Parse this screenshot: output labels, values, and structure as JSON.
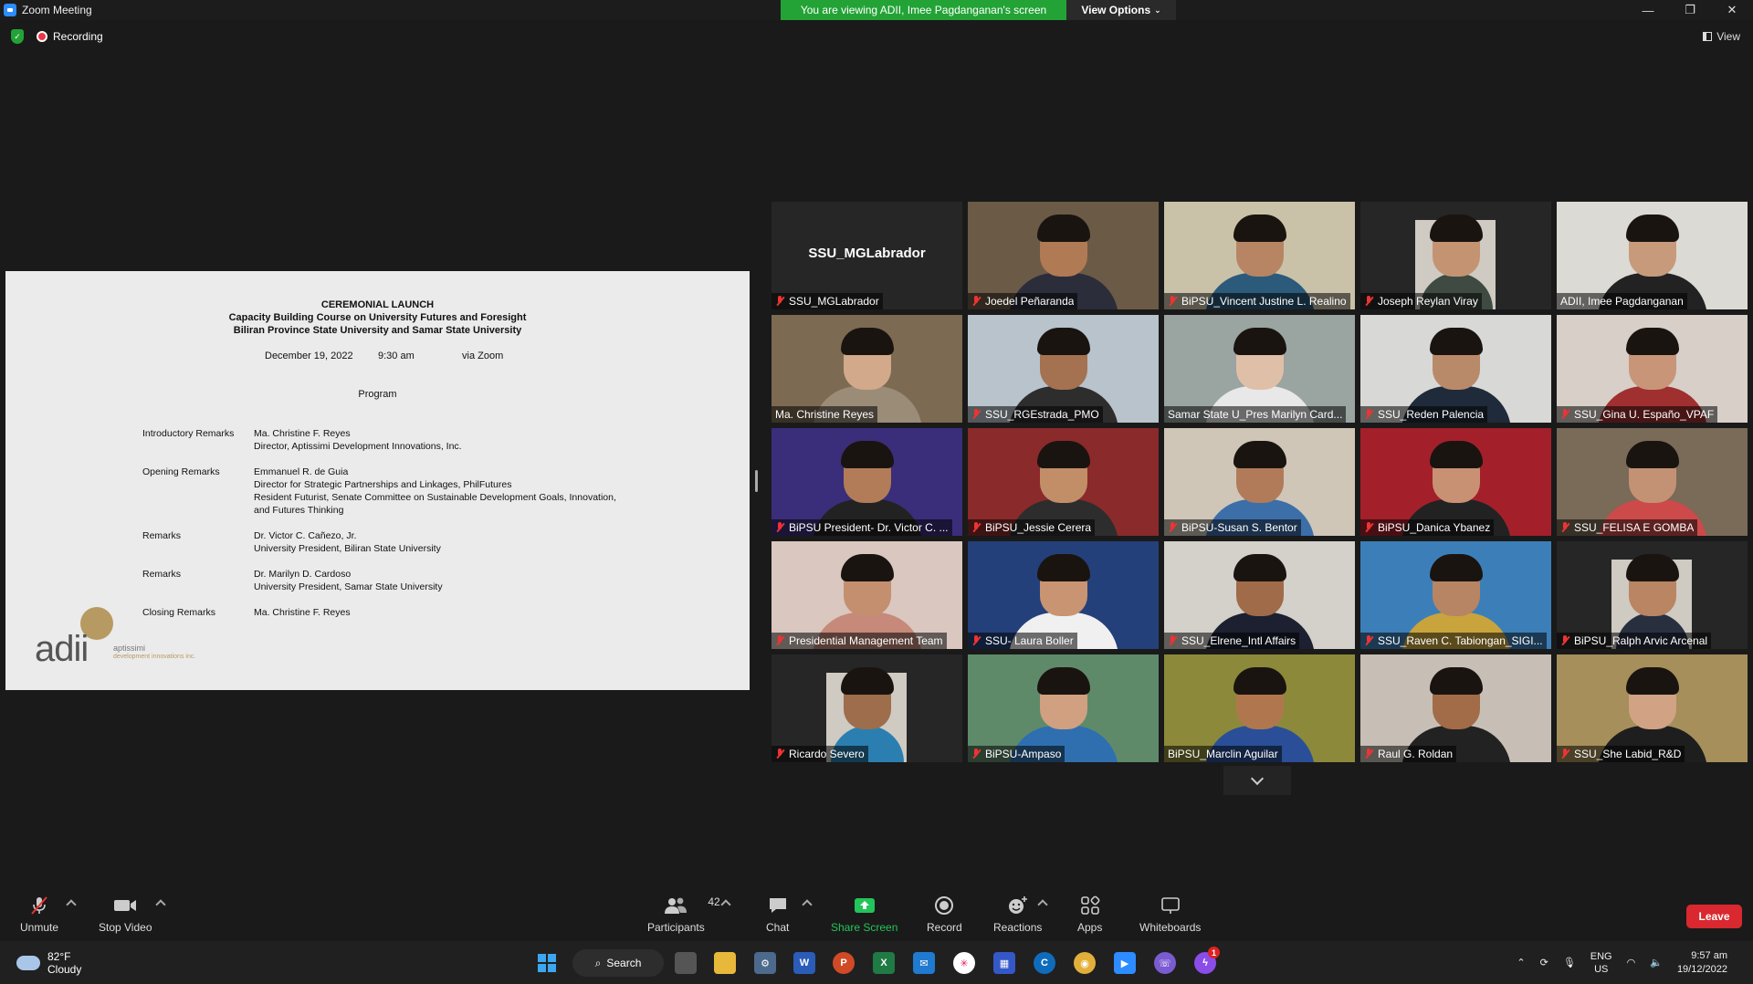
{
  "window": {
    "title": "Zoom Meeting",
    "viewing_banner": "You are viewing ADII, Imee Pagdanganan's screen",
    "view_options": "View Options"
  },
  "status": {
    "recording": "Recording",
    "view": "View"
  },
  "shared_doc": {
    "title_lines": [
      "CEREMONIAL LAUNCH",
      "Capacity Building Course on University Futures and Foresight",
      "Biliran Province State University and Samar State University"
    ],
    "date": "December 19, 2022",
    "time": "9:30 am",
    "venue": "via Zoom",
    "program_heading": "Program",
    "program": [
      {
        "label": "Introductory Remarks",
        "lines": [
          "Ma. Christine F. Reyes",
          "Director, Aptissimi Development Innovations, Inc."
        ]
      },
      {
        "label": "Opening Remarks",
        "lines": [
          "Emmanuel R. de Guia",
          "Director for Strategic Partnerships and Linkages, PhilFutures",
          "Resident Futurist, Senate Committee on Sustainable Development Goals, Innovation,",
          "and Futures Thinking"
        ]
      },
      {
        "label": "Remarks",
        "lines": [
          "Dr. Victor C. Cañezo, Jr.",
          "University President, Biliran State University"
        ]
      },
      {
        "label": "Remarks",
        "lines": [
          "Dr. Marilyn D. Cardoso",
          "University President, Samar State University"
        ]
      },
      {
        "label": "Closing Remarks",
        "lines": [
          "Ma. Christine F. Reyes"
        ]
      }
    ],
    "logo": {
      "word": "adii",
      "sub1": "aptissimi",
      "sub2": "development innovations inc."
    }
  },
  "participants": [
    {
      "name": "SSU_MGLabrador",
      "center_name": "SSU_MGLabrador",
      "muted": true,
      "bg": "#262626",
      "video": false
    },
    {
      "name": "Joedel Peñaranda",
      "muted": true,
      "bg": "#6b5a46",
      "skin": "#b07a55",
      "shirt": "#2b2d3a",
      "video": true
    },
    {
      "name": "BiPSU_Vincent Justine L. Realino",
      "muted": true,
      "bg": "#c9c2a8",
      "skin": "#b78563",
      "shirt": "#2c5a7a",
      "video": true
    },
    {
      "name": "Joseph Reylan Viray",
      "muted": true,
      "bg": "#262626",
      "skin": "#c49472",
      "shirt": "#3e4a42",
      "video": true,
      "small": true
    },
    {
      "name": "ADII, Imee Pagdanganan",
      "muted": false,
      "bg": "#dcdad4",
      "skin": "#c89a7c",
      "shirt": "#222",
      "video": true,
      "active": true
    },
    {
      "name": "Ma. Christine Reyes",
      "muted": false,
      "bg": "#7d6a52",
      "skin": "#d2a98a",
      "shirt": "#9b8c78",
      "video": true
    },
    {
      "name": "SSU_RGEstrada_PMO",
      "muted": true,
      "bg": "#b8c3cc",
      "skin": "#a47250",
      "shirt": "#2d2d2d",
      "video": true
    },
    {
      "name": "Samar State U_Pres Marilyn Card...",
      "muted": false,
      "bg": "#9aa4a0",
      "skin": "#e0bfa8",
      "shirt": "#e8e8e8",
      "video": true
    },
    {
      "name": "SSU_Reden Palencia",
      "muted": true,
      "bg": "#d8d8d6",
      "skin": "#b98a6a",
      "shirt": "#1f2a3a",
      "video": true
    },
    {
      "name": "SSU_Gina U. Españo_VPAF",
      "muted": true,
      "bg": "#d7cfc8",
      "skin": "#c99578",
      "shirt": "#a03030",
      "video": true
    },
    {
      "name": "BiPSU President- Dr. Victor C. ...",
      "muted": true,
      "bg": "#3a2d7a",
      "skin": "#b27c58",
      "shirt": "#222",
      "video": true
    },
    {
      "name": "BiPSU_Jessie Cerera",
      "muted": true,
      "bg": "#8a2a2a",
      "skin": "#c28e68",
      "shirt": "#2d2d2d",
      "video": true
    },
    {
      "name": "BiPSU-Susan S. Bentor",
      "muted": true,
      "bg": "#cfc6b8",
      "skin": "#b17b5a",
      "shirt": "#3c6ea8",
      "video": true
    },
    {
      "name": "BiPSU_Danica Ybanez",
      "muted": true,
      "bg": "#a3202a",
      "skin": "#c99173",
      "shirt": "#222",
      "video": true
    },
    {
      "name": "SSU_FELISA E GOMBA",
      "muted": true,
      "bg": "#7a6a58",
      "skin": "#c39274",
      "shirt": "#cc4a4a",
      "video": true
    },
    {
      "name": "Presidential Management Team",
      "muted": true,
      "bg": "#d9c7c0",
      "skin": "#c48f6f",
      "shirt": "#c6897a",
      "video": true
    },
    {
      "name": "SSU- Laura Boller",
      "muted": true,
      "bg": "#24407a",
      "skin": "#c99472",
      "shirt": "#f0f0f0",
      "video": true
    },
    {
      "name": "SSU_Elrene_Intl Affairs",
      "muted": true,
      "bg": "#d4d0ca",
      "skin": "#a06b48",
      "shirt": "#1c2030",
      "video": true
    },
    {
      "name": "SSU_Raven C. Tabiongan_SIGI...",
      "muted": true,
      "bg": "#3c7fb8",
      "skin": "#b78563",
      "shirt": "#c9a43c",
      "video": true
    },
    {
      "name": "BiPSU_Ralph Arvic Arcenal",
      "muted": true,
      "bg": "#262626",
      "skin": "#b98563",
      "shirt": "#283040",
      "video": true,
      "small": true
    },
    {
      "name": "Ricardo Severo",
      "muted": true,
      "bg": "#262626",
      "skin": "#9d6d4c",
      "shirt": "#2a7fb0",
      "video": true,
      "small": true
    },
    {
      "name": "BiPSU-Ampaso",
      "muted": true,
      "bg": "#5f8a6a",
      "skin": "#d1a080",
      "shirt": "#2f6fb0",
      "video": true
    },
    {
      "name": "BiPSU_Marclin Aguilar",
      "muted": false,
      "bg": "#8c8a3a",
      "skin": "#b0774f",
      "shirt": "#2a4f98",
      "video": true
    },
    {
      "name": "Raul G. Roldan",
      "muted": true,
      "bg": "#c7bfb5",
      "skin": "#a26c48",
      "shirt": "#222",
      "video": true
    },
    {
      "name": "SSU_She Labid_R&D",
      "muted": true,
      "bg": "#a68f5a",
      "skin": "#d1a284",
      "shirt": "#1e1e1e",
      "video": true
    }
  ],
  "toolbar": {
    "unmute": "Unmute",
    "stop_video": "Stop Video",
    "participants": "Participants",
    "participants_count": "42",
    "chat": "Chat",
    "share_screen": "Share Screen",
    "record": "Record",
    "reactions": "Reactions",
    "apps": "Apps",
    "whiteboards": "Whiteboards",
    "leave": "Leave"
  },
  "taskbar": {
    "temp": "82°F",
    "weather": "Cloudy",
    "search": "Search",
    "lang1": "ENG",
    "lang2": "US",
    "time": "9:57 am",
    "date": "19/12/2022",
    "messenger_badge": "1"
  },
  "colors": {
    "banner_green": "#23a336",
    "leave_red": "#d9282f",
    "active_speaker": "#c8e84a",
    "muted_red": "#e33333"
  }
}
